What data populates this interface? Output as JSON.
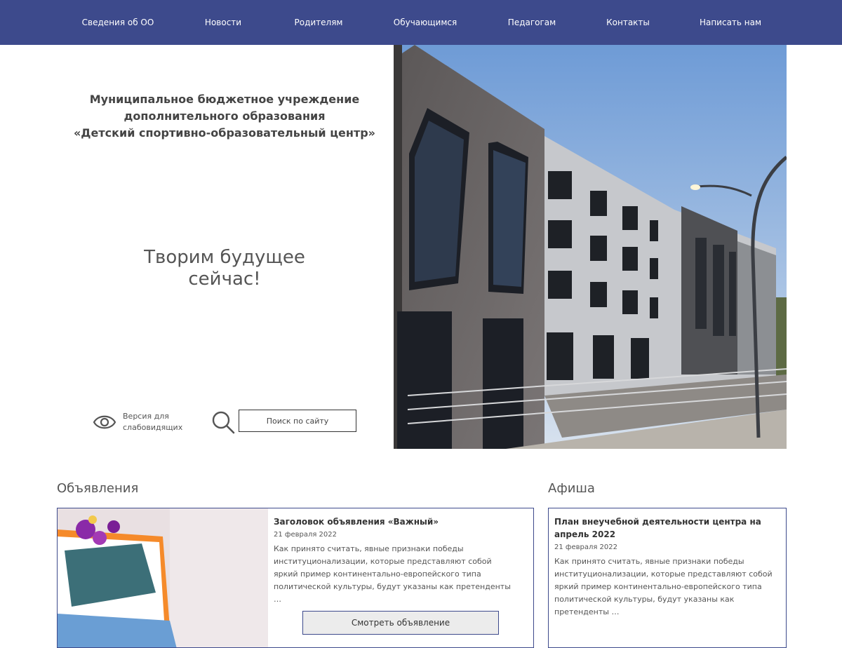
{
  "nav": {
    "items": [
      {
        "label": "Сведения об ОО"
      },
      {
        "label": "Новости"
      },
      {
        "label": "Родителям"
      },
      {
        "label": "Обучающимся"
      },
      {
        "label": "Педагогам"
      },
      {
        "label": "Контакты"
      },
      {
        "label": "Написать нам"
      }
    ]
  },
  "header": {
    "title_line1": "Муниципальное бюджетное учреждение",
    "title_line2": "дополнительного образования",
    "title_line3": "«Детский спортивно-образовательный центр»",
    "slogan_line1": "Творим будущее",
    "slogan_line2": "сейчас!"
  },
  "tools": {
    "vision_line1": "Версия для",
    "vision_line2": "слабовидящих",
    "search_placeholder": "Поиск по сайту"
  },
  "announcements": {
    "section_title": "Объявления",
    "card": {
      "title": "Заголовок объявления «Важный»",
      "date": "21 февраля 2022",
      "text": "Как принято считать, явные признаки победы институционализации, которые представляют собой яркий пример континентально-европейского типа политической культуры, будут указаны как претенденты …",
      "button": "Смотреть объявление"
    }
  },
  "afisha": {
    "section_title": "Афиша",
    "card": {
      "title": "План внеучебной деятельности центра на апрель 2022",
      "date": "21 февраля 2022",
      "text": "Как принято считать, явные признаки победы институционализации, которые представляют собой яркий пример континентально-европейского типа политической культуры, будут указаны как претенденты …"
    }
  },
  "colors": {
    "nav_bg": "#3d4a8c",
    "card_border": "#3d4a8c",
    "button_bg": "#ececec"
  },
  "icons": [
    "eye-icon",
    "search-icon"
  ]
}
